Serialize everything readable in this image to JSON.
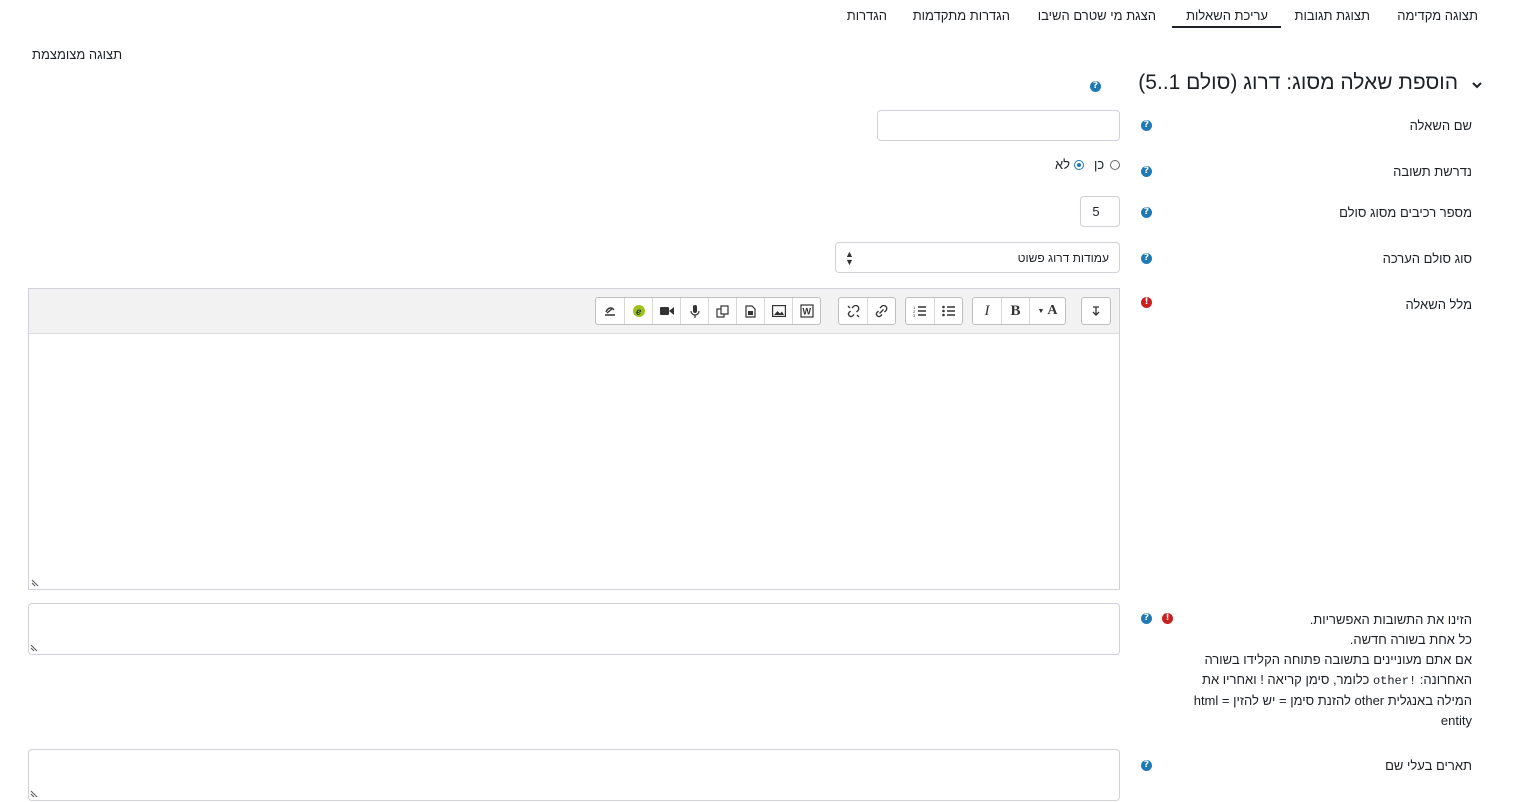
{
  "tabs": [
    {
      "label": "תצוגה מקדימה",
      "active": false
    },
    {
      "label": "תצוגת תגובות",
      "active": false
    },
    {
      "label": "עריכת השאלות",
      "active": true
    },
    {
      "label": "הצגת מי שטרם השיבו",
      "active": false
    },
    {
      "label": "הגדרות מתקדמות",
      "active": false
    },
    {
      "label": "הגדרות",
      "active": false
    }
  ],
  "compact_view_label": "תצוגה מצומצמת",
  "section": {
    "title": "הוספת שאלה מסוג: דרוג (סולם 1..5)"
  },
  "fields": {
    "question_name": {
      "label": "שם השאלה",
      "value": ""
    },
    "response_required": {
      "label": "נדרשת תשובה",
      "yes_label": "כן",
      "no_label": "לא",
      "selected": "no"
    },
    "scale_items": {
      "label": "מספר רכיבים מסוג סולם",
      "value": "5"
    },
    "scale_type": {
      "label": "סוג סולם הערכה",
      "selected": "עמודות דרוג פשוט"
    },
    "question_text": {
      "label": "מלל השאלה",
      "value": ""
    },
    "possible_answers": {
      "label_lines": [
        "הזינו את התשובות האפשריות.",
        "כל אחת בשורה חדשה."
      ],
      "help_1": "אם אתם מעוניינים בתשובה פתוחה הקלידו בשורה האחרונה:",
      "code": "!other",
      "help_2": "כלומר, סימן קריאה ! ואחריו את המילה באנגלית other להזנת סימן = יש להזין = html entity",
      "value": ""
    },
    "named_degree": {
      "label": "תארים בעלי שם",
      "value": ""
    }
  },
  "toolbar": {
    "groups": [
      [
        "arrow-down-icon"
      ],
      [
        "font-color-icon",
        "bold-icon",
        "italic-icon"
      ],
      [
        "bullet-list-icon",
        "numbered-list-icon"
      ],
      [
        "link-icon",
        "unlink-icon"
      ],
      [
        "word-import-icon",
        "image-icon",
        "media-icon",
        "manage-files-icon",
        "record-audio-icon",
        "record-video-icon",
        "h5p-icon",
        "accessibility-icon"
      ]
    ],
    "bold": "B",
    "italic": "I",
    "font": "A"
  },
  "colors": {
    "accent": "#1f7ab3",
    "required": "#ca1f1f",
    "text": "#1d2125",
    "border": "#cfd3d7"
  }
}
